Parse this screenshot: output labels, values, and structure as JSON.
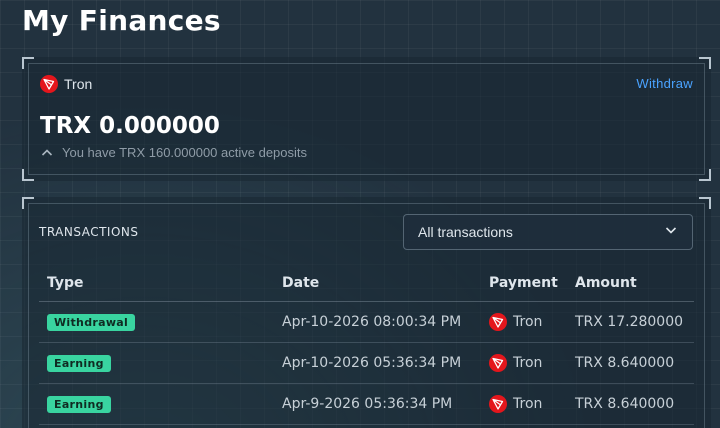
{
  "page": {
    "title": "My Finances"
  },
  "balance": {
    "currency_name": "Tron",
    "currency_icon": "tron-logo-icon",
    "withdraw_label": "Withdraw",
    "amount": "TRX 0.000000",
    "deposits_text": "You have TRX 160.000000 active deposits"
  },
  "transactions": {
    "heading": "TRANSACTIONS",
    "filter": {
      "selected": "All transactions"
    },
    "columns": {
      "type": "Type",
      "date": "Date",
      "payment": "Payment",
      "amount": "Amount"
    },
    "rows": [
      {
        "type": "Withdrawal",
        "date": "Apr-10-2026 08:00:34 PM",
        "payment": "Tron",
        "amount": "TRX 17.280000"
      },
      {
        "type": "Earning",
        "date": "Apr-10-2026 05:36:34 PM",
        "payment": "Tron",
        "amount": "TRX 8.640000"
      },
      {
        "type": "Earning",
        "date": "Apr-9-2026 05:36:34 PM",
        "payment": "Tron",
        "amount": "TRX 8.640000"
      }
    ]
  },
  "colors": {
    "background": "#22323f",
    "accent_link": "#4aa3ff",
    "badge": "#39d4a0",
    "tron_red": "#e4161c"
  }
}
